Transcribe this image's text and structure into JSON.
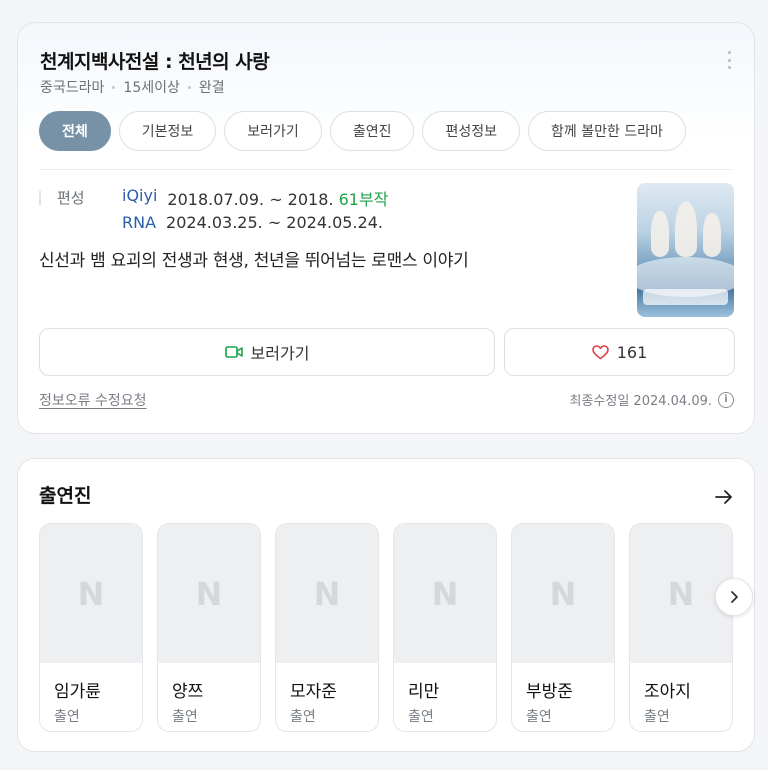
{
  "info_card": {
    "title": "천계지백사전설 : 천년의 사랑",
    "meta": [
      "중국드라마",
      "15세이상",
      "완결"
    ],
    "tabs": [
      "전체",
      "기본정보",
      "보러가기",
      "출연진",
      "편성정보",
      "함께 볼만한 드라마"
    ],
    "active_tab": "전체",
    "schedule_label": "편성",
    "schedule": [
      {
        "network": "iQiyi",
        "dates": "2018.07.09. ~ 2018.",
        "episodes": "61부작"
      },
      {
        "network": "RNA",
        "dates": "2024.03.25. ~ 2024.05.24.",
        "episodes": ""
      }
    ],
    "description": "신선과 뱀 요괴의 전생과 현생, 천년을 뛰어넘는 로맨스 이야기",
    "watch_label": "보러가기",
    "like_count": "161",
    "report_link": "정보오류 수정요청",
    "updated": "최종수정일 2024.04.09.",
    "colors": {
      "active_tab": "#7792a6",
      "episodes": "#1fa34a",
      "network": "#2b5ea8",
      "video_icon": "#1fa34a",
      "heart": "#e0404a"
    }
  },
  "cast_section": {
    "title": "출연진",
    "placeholder_glyph": "N",
    "members": [
      {
        "name": "임가륜",
        "role": "출연"
      },
      {
        "name": "양쯔",
        "role": "출연"
      },
      {
        "name": "모자준",
        "role": "출연"
      },
      {
        "name": "리만",
        "role": "출연"
      },
      {
        "name": "부방준",
        "role": "출연"
      },
      {
        "name": "조아지",
        "role": "출연"
      }
    ]
  },
  "icons": {
    "more": "more-vertical-icon",
    "video": "video-camera-icon",
    "heart": "heart-icon",
    "info": "info-icon",
    "arrow": "arrow-right-icon",
    "next": "chevron-right-icon"
  }
}
